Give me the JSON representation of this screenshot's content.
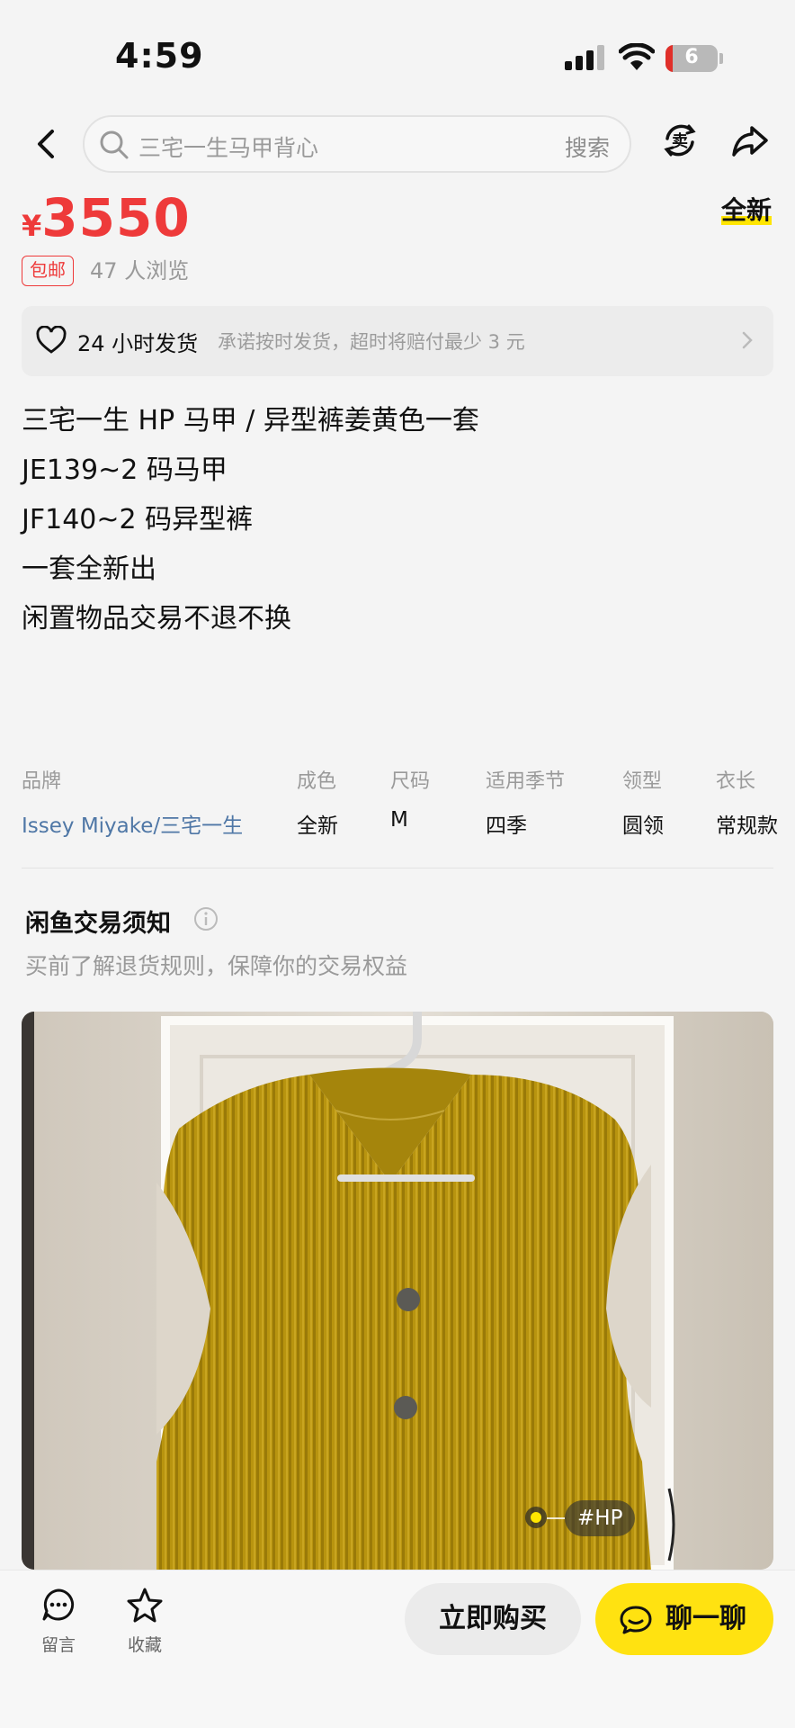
{
  "status_bar": {
    "time": "4:59",
    "battery": "6"
  },
  "search": {
    "placeholder": "三宅一生马甲背心",
    "button": "搜索"
  },
  "icons": {
    "back": "back-chevron-icon",
    "sell": "sell-icon",
    "share": "share-icon",
    "heart": "heart-icon",
    "info": "info-icon",
    "chat": "chat-bubble-icon",
    "star": "star-icon"
  },
  "product": {
    "currency": "¥",
    "price": "3550",
    "condition": "全新",
    "free_shipping": "包邮",
    "views": "47 人浏览"
  },
  "promise": {
    "title": "24 小时发货",
    "desc": "承诺按时发货，超时将赔付最少 3 元"
  },
  "description": [
    "三宅一生 HP 马甲 / 异型裤姜黄色一套",
    "JE139~2 码马甲",
    "JF140~2 码异型裤",
    "一套全新出",
    "闲置物品交易不退不换"
  ],
  "attributes": [
    {
      "key": "品牌",
      "value": "Issey Miyake/三宅一生"
    },
    {
      "key": "成色",
      "value": "全新"
    },
    {
      "key": "尺码",
      "value": "M"
    },
    {
      "key": "适用季节",
      "value": "四季"
    },
    {
      "key": "领型",
      "value": "圆领"
    },
    {
      "key": "衣长",
      "value": "常规款"
    }
  ],
  "notice": {
    "title": "闲鱼交易须知",
    "subtitle": "买前了解退货规则，保障你的交易权益"
  },
  "photo": {
    "tag": "#HP"
  },
  "bottom_bar": {
    "comment_label": "留言",
    "favorite_label": "收藏",
    "buy_label": "立即购买",
    "chat_label": "聊一聊"
  },
  "colors": {
    "price_red": "#ee3a3a",
    "accent_yellow": "#ffe211",
    "link_blue": "#4f77a6",
    "vest_mustard": "#b8940f"
  }
}
